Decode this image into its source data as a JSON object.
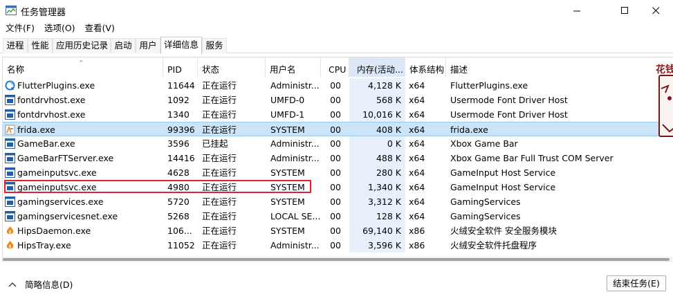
{
  "window": {
    "title": "任务管理器",
    "minimize": "—",
    "maximize": "☐",
    "close": "✕"
  },
  "menu": [
    "文件(F)",
    "选项(O)",
    "查看(V)"
  ],
  "tabs": [
    "进程",
    "性能",
    "应用历史记录",
    "启动",
    "用户",
    "详细信息",
    "服务"
  ],
  "active_tab": "详细信息",
  "columns": {
    "name": "名称",
    "pid": "PID",
    "status": "状态",
    "user": "用户名",
    "cpu": "CPU",
    "memory": "内存(活动...",
    "arch": "体系结构",
    "desc": "描述"
  },
  "sort_indicator": "^",
  "rows": [
    {
      "name": "FlutterPlugins.exe",
      "pid": "11644",
      "status": "正在运行",
      "user": "Administr...",
      "cpu": "00",
      "memory": "4,128 K",
      "arch": "x64",
      "desc": "FlutterPlugins.exe",
      "icon": "flutter-app-icon"
    },
    {
      "name": "fontdrvhost.exe",
      "pid": "1092",
      "status": "正在运行",
      "user": "UMFD-0",
      "cpu": "00",
      "memory": "568 K",
      "arch": "x64",
      "desc": "Usermode Font Driver Host",
      "icon": "window-app-icon"
    },
    {
      "name": "fontdrvhost.exe",
      "pid": "1340",
      "status": "正在运行",
      "user": "UMFD-1",
      "cpu": "00",
      "memory": "10,016 K",
      "arch": "x64",
      "desc": "Usermode Font Driver Host",
      "icon": "window-app-icon"
    },
    {
      "name": "frida.exe",
      "pid": "99396",
      "status": "正在运行",
      "user": "SYSTEM",
      "cpu": "00",
      "memory": "408 K",
      "arch": "x64",
      "desc": "frida.exe",
      "icon": "frida-app-icon"
    },
    {
      "name": "GameBar.exe",
      "pid": "3596",
      "status": "已挂起",
      "user": "Administr...",
      "cpu": "00",
      "memory": "0 K",
      "arch": "x64",
      "desc": "Xbox Game Bar",
      "icon": "window-app-icon"
    },
    {
      "name": "GameBarFTServer.exe",
      "pid": "14416",
      "status": "正在运行",
      "user": "Administr...",
      "cpu": "00",
      "memory": "488 K",
      "arch": "x64",
      "desc": "Xbox Game Bar Full Trust COM Server",
      "icon": "window-app-icon"
    },
    {
      "name": "gameinputsvc.exe",
      "pid": "4628",
      "status": "正在运行",
      "user": "SYSTEM",
      "cpu": "00",
      "memory": "280 K",
      "arch": "x64",
      "desc": "GameInput Host Service",
      "icon": "window-app-icon"
    },
    {
      "name": "gameinputsvc.exe",
      "pid": "4980",
      "status": "正在运行",
      "user": "SYSTEM",
      "cpu": "00",
      "memory": "1,340 K",
      "arch": "x64",
      "desc": "GameInput Host Service",
      "icon": "window-app-icon"
    },
    {
      "name": "gamingservices.exe",
      "pid": "5720",
      "status": "正在运行",
      "user": "SYSTEM",
      "cpu": "00",
      "memory": "3,312 K",
      "arch": "x64",
      "desc": "GamingServices",
      "icon": "window-app-icon"
    },
    {
      "name": "gamingservicesnet.exe",
      "pid": "5268",
      "status": "正在运行",
      "user": "LOCAL SE...",
      "cpu": "00",
      "memory": "128 K",
      "arch": "x64",
      "desc": "GamingServices",
      "icon": "window-app-icon"
    },
    {
      "name": "HipsDaemon.exe",
      "pid": "106...",
      "status": "正在运行",
      "user": "SYSTEM",
      "cpu": "00",
      "memory": "69,140 K",
      "arch": "x86",
      "desc": "火绒安全软件 安全服务模块",
      "icon": "huorong-app-icon"
    },
    {
      "name": "HipsTray.exe",
      "pid": "11052",
      "status": "正在运行",
      "user": "Administr...",
      "cpu": "00",
      "memory": "3,596 K",
      "arch": "x86",
      "desc": "火绒安全软件托盘程序",
      "icon": "huorong-app-icon"
    }
  ],
  "selected_row": 3,
  "footer": {
    "fewer_details": "简略信息(D)",
    "end_task": "结束任务(E)"
  },
  "side_decoration_text": "花钱",
  "colors": {
    "selection": "#cce4f7",
    "highlight_box": "#e0202e",
    "sorted_header": "#dce8f7"
  }
}
